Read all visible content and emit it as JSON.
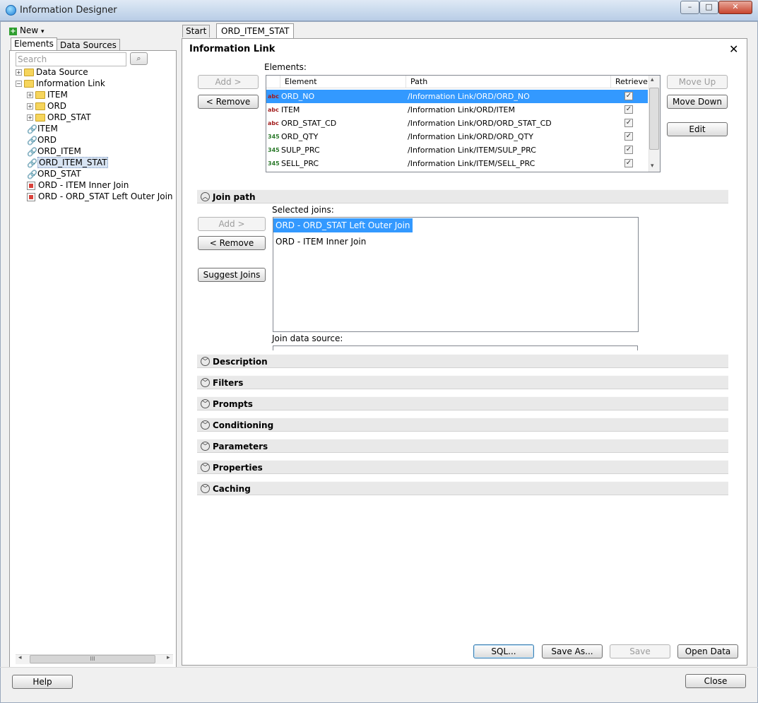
{
  "window": {
    "title": "Information Designer",
    "minimize_symbol": "–",
    "maximize_symbol": "□",
    "close_symbol": "✕"
  },
  "left_panel": {
    "new_label": "New",
    "new_caret": "▾",
    "tabs": {
      "elements": "Elements",
      "data_sources": "Data Sources"
    },
    "search_placeholder": "Search",
    "search_icon": "⌕",
    "tree": {
      "data_source": "Data Source",
      "information_link": "Information Link",
      "folders": [
        "ITEM",
        "ORD",
        "ORD_STAT"
      ],
      "links": [
        "ITEM",
        "ORD",
        "ORD_ITEM",
        "ORD_ITEM_STAT",
        "ORD_STAT"
      ],
      "joins": [
        "ORD - ITEM  Inner Join",
        "ORD - ORD_STAT  Left Outer Join"
      ]
    },
    "scroll_grip": "III",
    "scroll_left": "◂",
    "scroll_right": "▸"
  },
  "editor_tabs": {
    "start": "Start",
    "active": "ORD_ITEM_STAT"
  },
  "panel": {
    "title": "Information Link",
    "close": "✕",
    "elements_label": "Elements:",
    "add_label": "Add >",
    "remove_label": "< Remove",
    "move_up_label": "Move Up",
    "move_down_label": "Move Down",
    "edit_label": "Edit",
    "columns": {
      "element": "Element",
      "path": "Path",
      "retrieve": "Retrieve"
    },
    "rows": [
      {
        "type": "abc",
        "element": "ORD_NO",
        "path": "/Information Link/ORD/ORD_NO",
        "retrieve": "✓"
      },
      {
        "type": "abc",
        "element": "ITEM",
        "path": "/Information Link/ORD/ITEM",
        "retrieve": "✓"
      },
      {
        "type": "abc",
        "element": "ORD_STAT_CD",
        "path": "/Information Link/ORD/ORD_STAT_CD",
        "retrieve": "✓"
      },
      {
        "type": "345",
        "element": "ORD_QTY",
        "path": "/Information Link/ORD/ORD_QTY",
        "retrieve": "✓"
      },
      {
        "type": "345",
        "element": "SULP_PRC",
        "path": "/Information Link/ITEM/SULP_PRC",
        "retrieve": "✓"
      },
      {
        "type": "345",
        "element": "SELL_PRC",
        "path": "/Information Link/ITEM/SELL_PRC",
        "retrieve": "✓"
      }
    ],
    "scroll_up": "▴",
    "scroll_down": "▾",
    "join_path": {
      "header": "Join path",
      "chevron": "︿",
      "selected_joins_label": "Selected joins:",
      "add_label": "Add >",
      "remove_label": "< Remove",
      "suggest_label": "Suggest Joins",
      "joins": [
        "ORD - ORD_STAT  Left Outer Join",
        "ORD - ITEM  Inner Join"
      ],
      "data_source_label": "Join data source:"
    },
    "sections": [
      "Description",
      "Filters",
      "Prompts",
      "Conditioning",
      "Parameters",
      "Properties",
      "Caching"
    ],
    "section_chevron": "﹀",
    "buttons": {
      "sql": "SQL...",
      "save_as": "Save As...",
      "save": "Save",
      "open_data": "Open Data"
    }
  },
  "footer": {
    "help": "Help",
    "close": "Close"
  },
  "colors": {
    "selection": "#3399ff",
    "tree_selection": "#d8e4f3"
  }
}
